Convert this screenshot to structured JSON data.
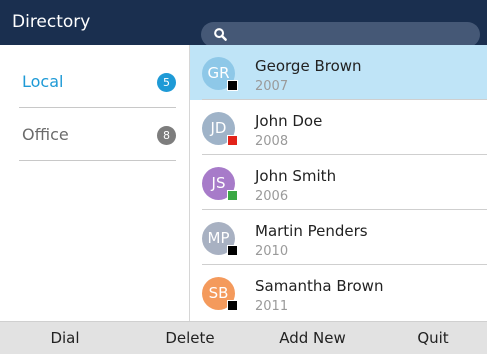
{
  "header": {
    "title": "Directory"
  },
  "search": {
    "icon": "search-icon"
  },
  "sidebar": {
    "items": [
      {
        "label": "Local",
        "count": "5",
        "color": "#1e9ad6",
        "badge_color": "#1e9ad6"
      },
      {
        "label": "Office",
        "count": "8",
        "color": "#6b6b6b",
        "badge_color": "#7d7d7d"
      }
    ]
  },
  "contacts": [
    {
      "initials": "GR",
      "name": "George Brown",
      "number": "2007",
      "avatar_color": "#8ec8e8",
      "status_color": "#000000"
    },
    {
      "initials": "JD",
      "name": "John Doe",
      "number": "2008",
      "avatar_color": "#9fb3c8",
      "status_color": "#e2231a"
    },
    {
      "initials": "JS",
      "name": "John Smith",
      "number": "2006",
      "avatar_color": "#a77bc9",
      "status_color": "#3aa843"
    },
    {
      "initials": "MP",
      "name": "Martin Penders",
      "number": "2010",
      "avatar_color": "#a8b1c2",
      "status_color": "#000000"
    },
    {
      "initials": "SB",
      "name": "Samantha Brown",
      "number": "2011",
      "avatar_color": "#f49a5c",
      "status_color": "#000000"
    }
  ],
  "softkeys": {
    "dial": "Dial",
    "delete": "Delete",
    "add_new": "Add New",
    "quit": "Quit"
  }
}
